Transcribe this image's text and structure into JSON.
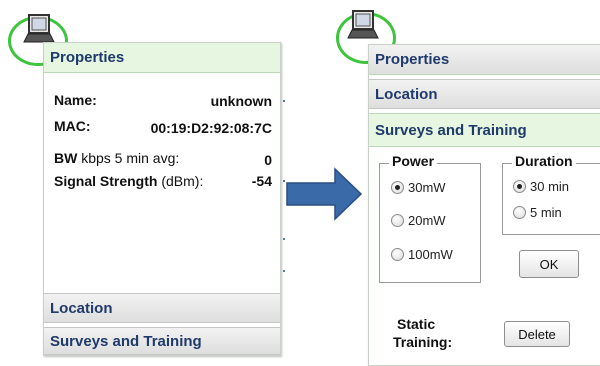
{
  "left_panel": {
    "header": "Properties",
    "name_label": "Name:",
    "name_value": "unknown",
    "mac_label": "MAC:",
    "mac_value": "00:19:D2:92:08:7C",
    "bw_label_bold": "BW",
    "bw_label_rest": " kbps 5 min avg:",
    "bw_value": "0",
    "signal_label_bold": "Signal Strength",
    "signal_label_rest": " (dBm):",
    "signal_value": "-54",
    "location_header": "Location",
    "surveys_header": "Surveys and Training"
  },
  "right_panel": {
    "properties_header": "Properties",
    "location_header": "Location",
    "surveys_header": "Surveys and Training",
    "power": {
      "legend": "Power",
      "options": [
        "30mW",
        "20mW",
        "100mW"
      ],
      "selected": "30mW"
    },
    "duration": {
      "legend": "Duration",
      "options": [
        "30 min",
        "5 min"
      ],
      "selected": "30 min"
    },
    "ok_label": "OK",
    "static_training_label_line1": "Static",
    "static_training_label_line2": "Training:",
    "delete_label": "Delete"
  },
  "colors": {
    "ring": "#3ec43e",
    "header_green": "#e6f6e0",
    "header_text": "#1f3a6b",
    "arrow": "#3a6aa8"
  }
}
